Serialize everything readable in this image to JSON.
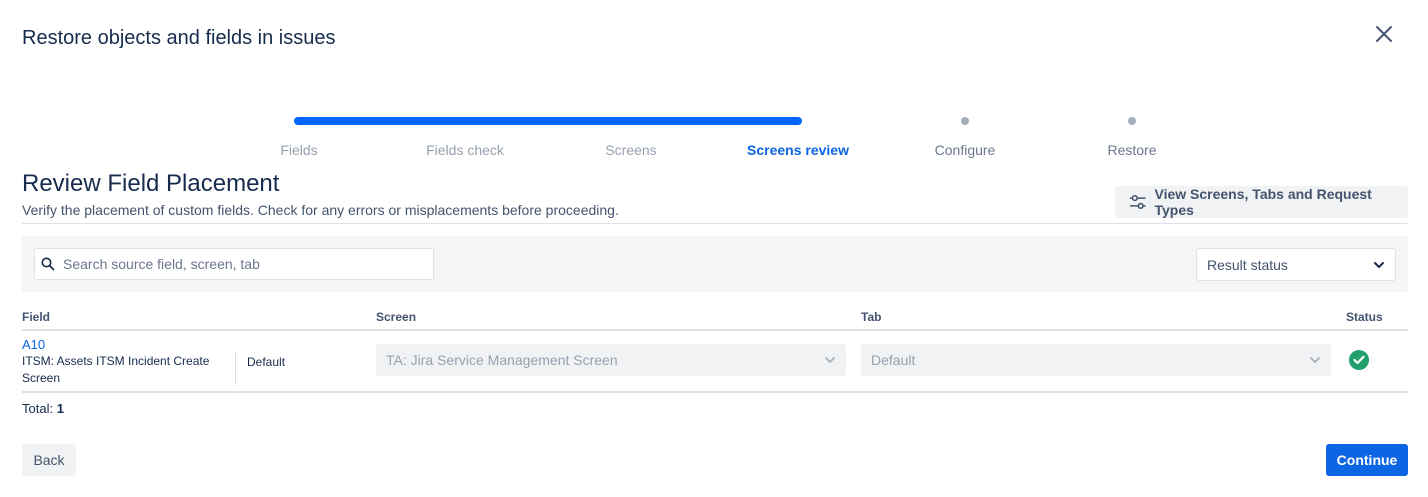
{
  "modal": {
    "title": "Restore objects and fields in issues"
  },
  "tracker": {
    "steps": [
      {
        "label": "Fields",
        "state": "done"
      },
      {
        "label": "Fields check",
        "state": "done"
      },
      {
        "label": "Screens",
        "state": "done"
      },
      {
        "label": "Screens review",
        "state": "active"
      },
      {
        "label": "Configure",
        "state": "pending"
      },
      {
        "label": "Restore",
        "state": "pending"
      }
    ],
    "active_color": "#0065ff"
  },
  "section": {
    "title": "Review Field Placement",
    "description": "Verify the placement of custom fields. Check for any errors or misplacements before proceeding.",
    "view_button_label": "View Screens, Tabs and Request Types",
    "view_button_icon": "sliders-icon"
  },
  "filters": {
    "search_placeholder": "Search source field, screen, tab",
    "search_value": "",
    "status_select_value": "Result status"
  },
  "table": {
    "headers": {
      "field": "Field",
      "screen": "Screen",
      "tab": "Tab",
      "status": "Status"
    },
    "rows": [
      {
        "field_name": "A10",
        "field_context": "ITSM: Assets ITSM Incident Create Screen",
        "field_tab": "Default",
        "screen": "TA: Jira Service Management Screen",
        "tab": "Default",
        "status": "success",
        "status_color": "#22a06b"
      }
    ]
  },
  "footer": {
    "total_label": "Total:",
    "total_value": "1",
    "back_label": "Back",
    "continue_label": "Continue"
  }
}
